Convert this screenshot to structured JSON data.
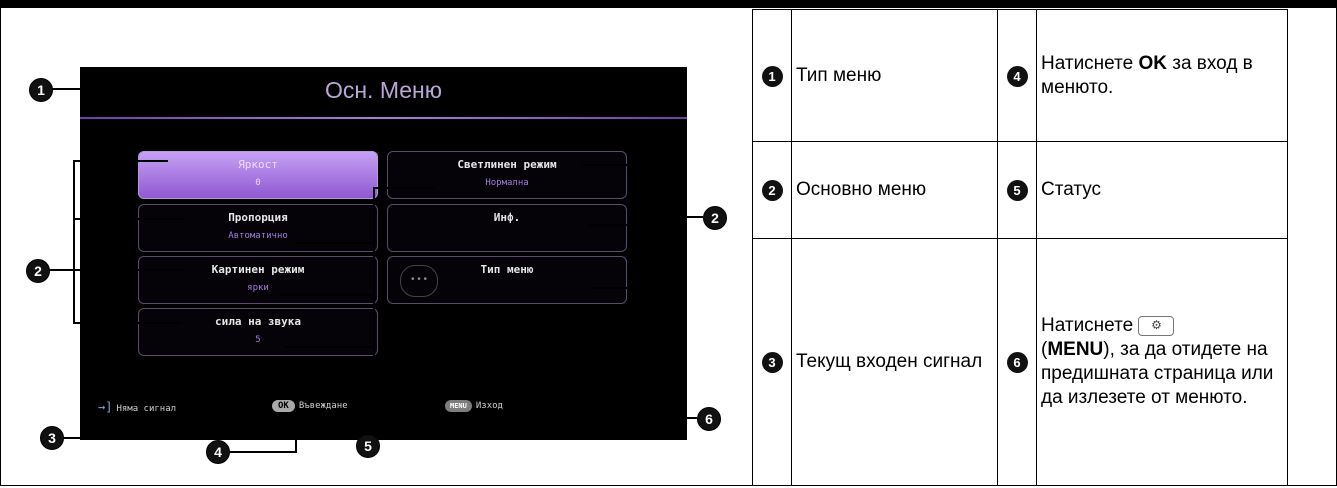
{
  "menu_screen": {
    "title": "Осн. Меню",
    "tiles": [
      {
        "label": "Яркост",
        "value": "0",
        "selected": true
      },
      {
        "label": "Светлинен режим",
        "value": "Нормална"
      },
      {
        "label": "Пропорция",
        "value": "Автоматично"
      },
      {
        "label": "Инф.",
        "value": ""
      },
      {
        "label": "Картинен режим",
        "value": "ярки"
      },
      {
        "label": "Тип меню",
        "value": ""
      },
      {
        "label": "сила на звука",
        "value": "5"
      }
    ],
    "footer": {
      "input_status": "Няма сигнал",
      "ok_pill": "OK",
      "ok_text": "Въвеждане",
      "menu_pill": "MENU",
      "menu_text": "Изход"
    }
  },
  "callouts": {
    "m1": "1",
    "m2": "2",
    "m3": "3",
    "m4": "4",
    "m5": "5",
    "m6": "6"
  },
  "legend": {
    "rows": [
      {
        "n1": "1",
        "t1": "Тип меню",
        "n2": "4",
        "t2_pre": "Натиснете ",
        "t2_bold": "OK",
        "t2_post": " за вход в менюто."
      },
      {
        "n1": "2",
        "t1": "Основно меню",
        "n2": "5",
        "t2": "Статус"
      },
      {
        "n1": "3",
        "t1": "Текущ входен сигнал",
        "n2": "6",
        "t2_pre": "Натиснете ",
        "t2_icon": "settings-gear-icon",
        "t2_open": "(",
        "t2_bold": "MENU",
        "t2_post": "), за да отидете на предишната страница или да излезете от менюто."
      }
    ]
  }
}
